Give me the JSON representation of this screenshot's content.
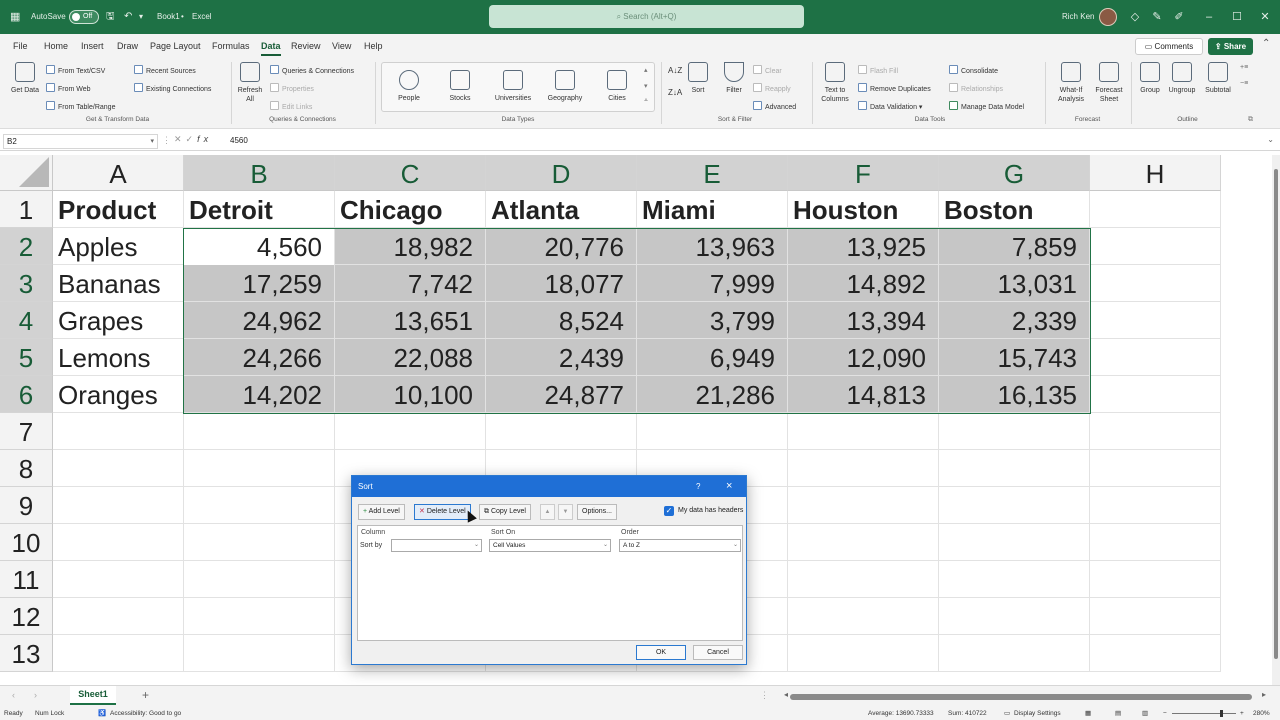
{
  "titlebar": {
    "autosave_label": "AutoSave",
    "autosave_state": "Off",
    "workbook": "Book1",
    "app": "Excel",
    "search_placeholder": "Search (Alt+Q)",
    "user": "Rich Ken"
  },
  "menu": [
    {
      "label": "File"
    },
    {
      "label": "Home"
    },
    {
      "label": "Insert"
    },
    {
      "label": "Draw"
    },
    {
      "label": "Page Layout"
    },
    {
      "label": "Formulas"
    },
    {
      "label": "Data",
      "active": true
    },
    {
      "label": "Review"
    },
    {
      "label": "View"
    },
    {
      "label": "Help"
    }
  ],
  "actions": {
    "comments": "Comments",
    "share": "Share"
  },
  "ribbon": {
    "get_data": "Get Data",
    "from_text": "From Text/CSV",
    "from_web": "From Web",
    "from_table": "From Table/Range",
    "recent_sources": "Recent Sources",
    "existing_connections": "Existing Connections",
    "group_get_transform": "Get & Transform Data",
    "refresh_all": "Refresh All",
    "queries_connections": "Queries & Connections",
    "properties": "Properties",
    "edit_links": "Edit Links",
    "group_queries": "Queries & Connections",
    "data_types": [
      "People",
      "Stocks",
      "Universities",
      "Geography",
      "Cities"
    ],
    "group_data_types": "Data Types",
    "sort": "Sort",
    "filter": "Filter",
    "clear": "Clear",
    "reapply": "Reapply",
    "advanced": "Advanced",
    "group_sort_filter": "Sort & Filter",
    "text_to_columns": "Text to Columns",
    "flash_fill": "Flash Fill",
    "remove_duplicates": "Remove Duplicates",
    "data_validation": "Data Validation",
    "consolidate": "Consolidate",
    "relationships": "Relationships",
    "manage_data_model": "Manage Data Model",
    "group_data_tools": "Data Tools",
    "what_if": "What-If Analysis",
    "forecast_sheet": "Forecast Sheet",
    "group_forecast": "Forecast",
    "group": "Group",
    "ungroup": "Ungroup",
    "subtotal": "Subtotal",
    "group_outline": "Outline"
  },
  "formula_bar": {
    "name_box": "B2",
    "formula": "4560"
  },
  "sheet": {
    "columns": [
      "A",
      "B",
      "C",
      "D",
      "E",
      "F",
      "G",
      "H"
    ],
    "rows": [
      "1",
      "2",
      "3",
      "4",
      "5",
      "6",
      "7",
      "8",
      "9",
      "10",
      "11",
      "12",
      "13"
    ],
    "header": [
      "Product",
      "Detroit",
      "Chicago",
      "Atlanta",
      "Miami",
      "Houston",
      "Boston"
    ],
    "data": [
      [
        "Apples",
        "4,560",
        "18,982",
        "20,776",
        "13,963",
        "13,925",
        "7,859"
      ],
      [
        "Bananas",
        "17,259",
        "7,742",
        "18,077",
        "7,999",
        "14,892",
        "13,031"
      ],
      [
        "Grapes",
        "24,962",
        "13,651",
        "8,524",
        "3,799",
        "13,394",
        "2,339"
      ],
      [
        "Lemons",
        "24,266",
        "22,088",
        "2,439",
        "6,949",
        "12,090",
        "15,743"
      ],
      [
        "Oranges",
        "14,202",
        "10,100",
        "24,877",
        "21,286",
        "14,813",
        "16,135"
      ]
    ]
  },
  "sheet_tab": "Sheet1",
  "status": {
    "ready": "Ready",
    "numlock": "Num Lock",
    "accessibility": "Accessibility: Good to go",
    "average": "Average: 13690.73333",
    "sum": "Sum: 410722",
    "display_settings": "Display Settings",
    "zoom": "280%"
  },
  "dialog": {
    "title": "Sort",
    "help": "?",
    "close": "×",
    "add_level": "Add Level",
    "delete_level": "Delete Level",
    "copy_level": "Copy Level",
    "options": "Options...",
    "my_data_headers": "My data has headers",
    "headers_checked": true,
    "col_header": "Column",
    "sorton_header": "Sort On",
    "order_header": "Order",
    "sort_by": "Sort by",
    "sort_by_value": "",
    "sort_on_value": "Cell Values",
    "order_value": "A to Z",
    "ok": "OK",
    "cancel": "Cancel"
  }
}
